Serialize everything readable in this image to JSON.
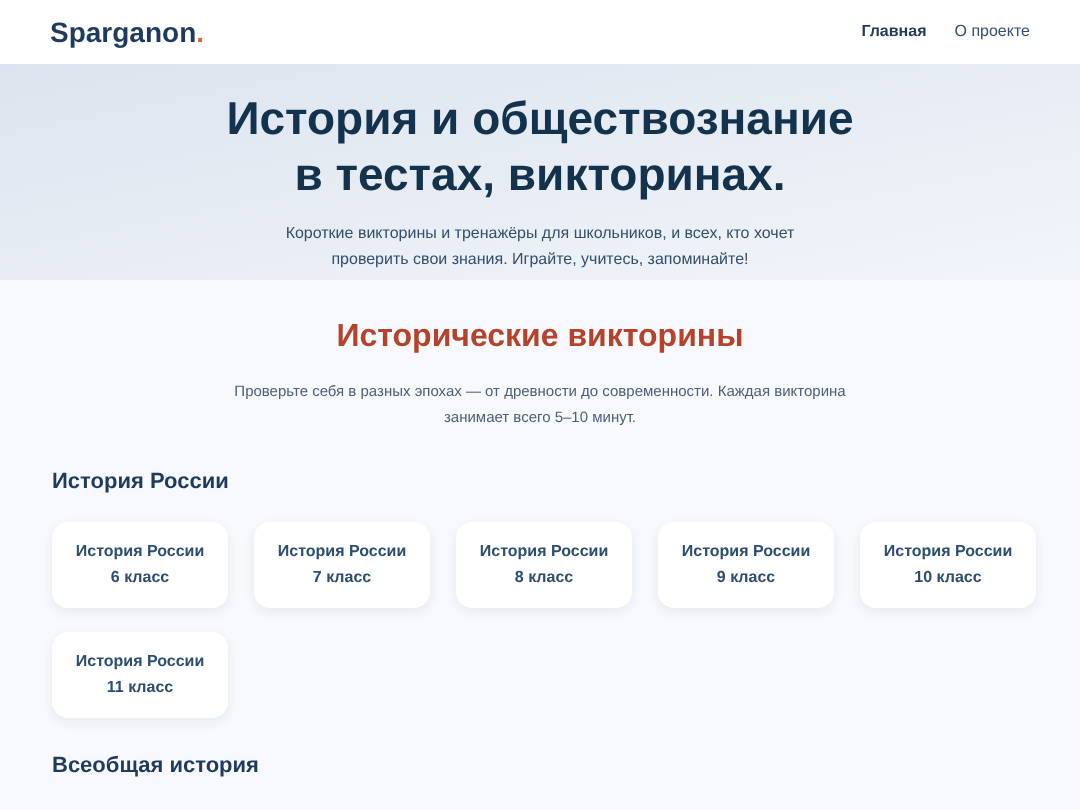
{
  "header": {
    "logo": "Sparganon",
    "logo_dot": ".",
    "nav": [
      {
        "label": "Главная",
        "selected": true
      },
      {
        "label": "О проекте",
        "selected": false
      }
    ]
  },
  "hero": {
    "title_lines": [
      "История и обществознание",
      "в тестах, викторинах."
    ],
    "subtitle": "Короткие викторины и тренажёры для школьников, и всех, кто хочет проверить свои знания. Играйте, учитесь, запоминайте!"
  },
  "quizzes": {
    "title": "Исторические викторины",
    "description": "Проверьте себя в разных эпохах — от древности до современности. Каждая викторина занимает всего 5–10 минут.",
    "sections": [
      {
        "heading": "История России",
        "cards": [
          {
            "title": "История России",
            "grade": "6 класс"
          },
          {
            "title": "История России",
            "grade": "7 класс"
          },
          {
            "title": "История России",
            "grade": "8 класс"
          },
          {
            "title": "История России",
            "grade": "9 класс"
          },
          {
            "title": "История России",
            "grade": "10 класс"
          },
          {
            "title": "История России",
            "grade": "11 класс"
          }
        ]
      },
      {
        "heading": "Всеобщая история"
      }
    ]
  }
}
